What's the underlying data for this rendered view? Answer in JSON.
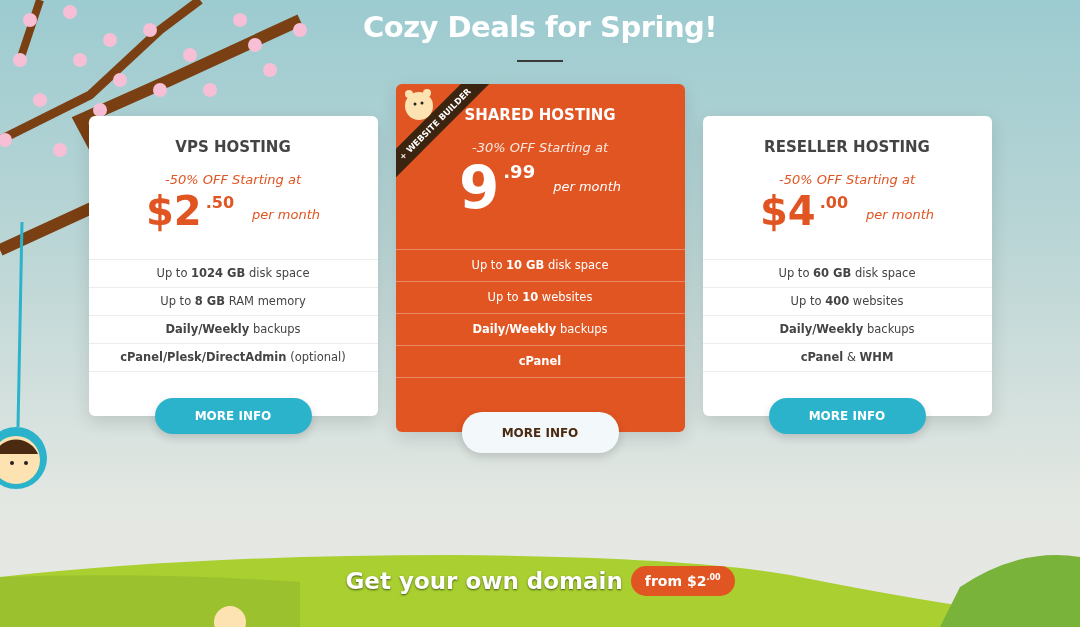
{
  "heading": "Cozy Deals for Spring!",
  "plans": [
    {
      "title": "VPS HOSTING",
      "featured": false,
      "offer": "-50% OFF Starting at",
      "price": "$2",
      "cents": ".50",
      "unit": "per month",
      "features": [
        "Up to **1024 GB** disk space",
        "Up to **8 GB** RAM memory",
        "**Daily/Weekly** backups",
        "**cPanel/Plesk/DirectAdmin** (optional)"
      ],
      "button": "MORE INFO"
    },
    {
      "title": "SHARED HOSTING",
      "featured": true,
      "ribbon": "+ WEBSITE BUILDER",
      "offer": "-30% OFF Starting at",
      "price": "9",
      "cents": ".99",
      "unit": "per month",
      "features": [
        "Up to **10 GB** disk space",
        "Up to **10** websites",
        "**Daily/Weekly** backups",
        "**cPanel**"
      ],
      "button": "MORE INFO"
    },
    {
      "title": "RESELLER HOSTING",
      "featured": false,
      "offer": "-50% OFF Starting at",
      "price": "$4",
      "cents": ".00",
      "unit": "per month",
      "features": [
        "Up to **60 GB** disk space",
        "Up to **400** websites",
        "**Daily/Weekly** backups",
        "**cPanel** & **WHM**"
      ],
      "button": "MORE INFO"
    }
  ],
  "domain": {
    "text": "Get your own domain",
    "badge": "from $2$^{.00}$"
  }
}
